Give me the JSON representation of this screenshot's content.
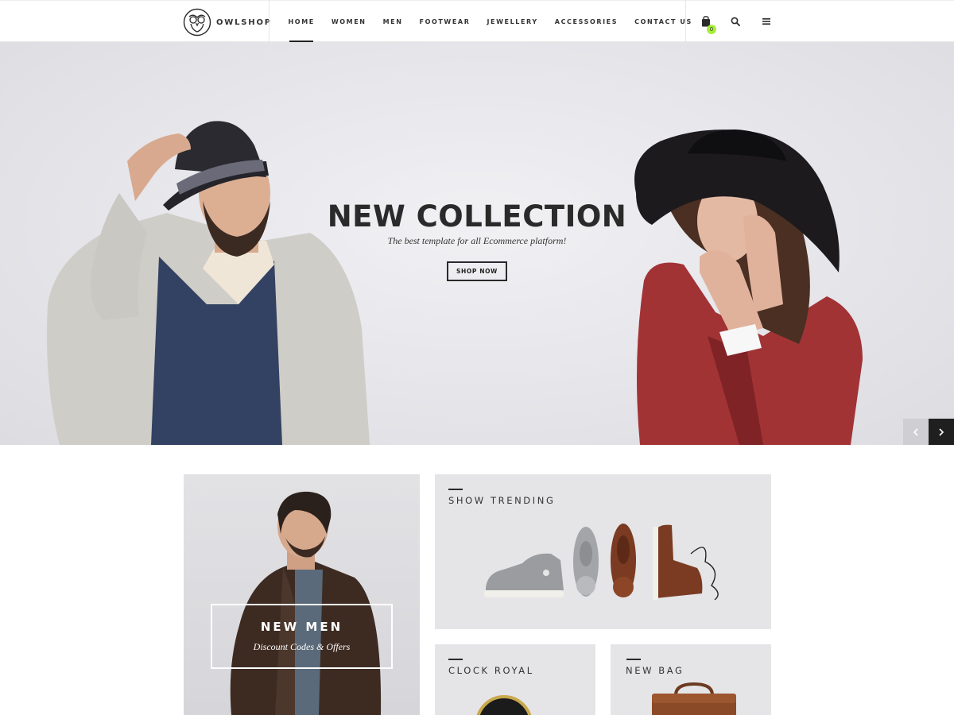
{
  "header": {
    "brand": "OWLSHOP",
    "nav": [
      {
        "label": "HOME",
        "active": true
      },
      {
        "label": "WOMEN",
        "active": false
      },
      {
        "label": "MEN",
        "active": false
      },
      {
        "label": "FOOTWEAR",
        "active": false
      },
      {
        "label": "JEWELLERY",
        "active": false
      },
      {
        "label": "ACCESSORIES",
        "active": false
      },
      {
        "label": "CONTACT US",
        "active": false
      }
    ],
    "cart_count": "0",
    "icons": [
      "cart-icon",
      "search-icon",
      "menu-icon"
    ],
    "accent_color": "#a8ee3a"
  },
  "hero": {
    "title": "NEW COLLECTION",
    "subtitle": "The best template for all Ecommerce platform!",
    "button": "SHOP NOW",
    "prev_icon": "chevron-left-icon",
    "next_icon": "chevron-right-icon"
  },
  "promos": {
    "men": {
      "title": "NEW MEN",
      "subtitle": "Discount Codes & Offers"
    },
    "trending": {
      "title": "SHOW TRENDING"
    },
    "clock": {
      "title": "CLOCK ROYAL"
    },
    "bag": {
      "title": "NEW BAG"
    }
  }
}
